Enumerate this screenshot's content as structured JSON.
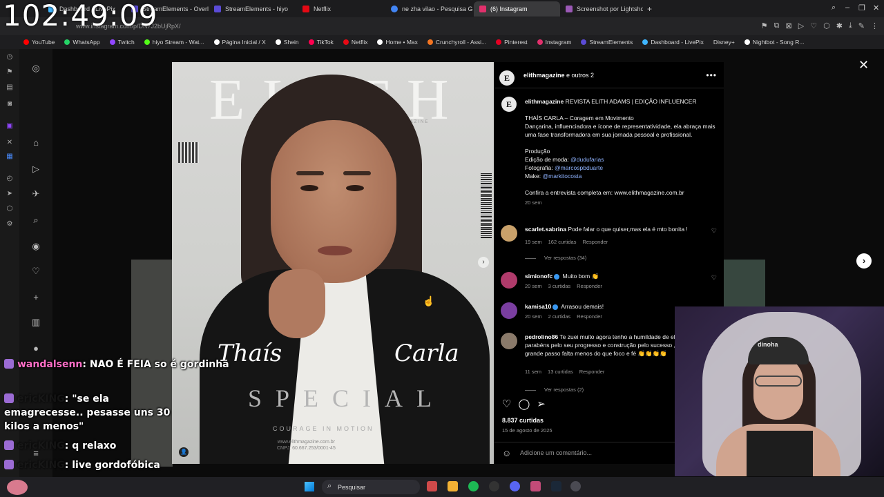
{
  "clock": "102:49:09",
  "browser": {
    "tabs": [
      {
        "label": "Dashboard - LivePix",
        "color": "#3fb5ff"
      },
      {
        "label": "StreamElements - Overlay",
        "color": "#5b4bd6"
      },
      {
        "label": "StreamElements - hiyo",
        "color": "#5b4bd6"
      },
      {
        "label": "Netflix",
        "color": "#e50914"
      },
      {
        "label": "ne zha vilao - Pesquisa G",
        "color": "#4285f4"
      },
      {
        "label": "(6) Instagram",
        "color": "#e1306c"
      },
      {
        "label": "Screenshot por Lightshot",
        "color": "#9b59b6"
      }
    ],
    "new_tab": "+",
    "url": "www.instagram.com/p/DN7J2bUjRpX/"
  },
  "bookmarks": [
    {
      "label": "YouTube",
      "color": "#ff0000"
    },
    {
      "label": "WhatsApp",
      "color": "#25d366"
    },
    {
      "label": "Twitch",
      "color": "#9146ff"
    },
    {
      "label": "hiyo Stream - Wat...",
      "color": "#53fc18"
    },
    {
      "label": "Página Inicial / X",
      "color": "#ffffff"
    },
    {
      "label": "Shein",
      "color": "#ffffff"
    },
    {
      "label": "TikTok",
      "color": "#ff0050"
    },
    {
      "label": "Netflix",
      "color": "#e50914"
    },
    {
      "label": "Home • Max",
      "color": "#ffffff"
    },
    {
      "label": "Crunchyroll - Assi...",
      "color": "#f47521"
    },
    {
      "label": "Pinterest",
      "color": "#e60023"
    },
    {
      "label": "Instagram",
      "color": "#e1306c"
    },
    {
      "label": "StreamElements",
      "color": "#5b4bd6"
    },
    {
      "label": "Dashboard - LivePix",
      "color": "#3fb5ff"
    },
    {
      "label": "Disney+",
      "color": "#113ccf"
    },
    {
      "label": "Nightbot - Song R...",
      "color": "#ffffff"
    }
  ],
  "cover": {
    "brand": "ELITH",
    "subtitle": "ADAMS MAGAZINE",
    "first_name": "Thaís",
    "last_name": "Carla",
    "special": "SPECIAL",
    "tagline": "COURAGE IN MOTION",
    "site": "www.elithmagazine.com.br",
    "cnpj": "CNPJ: 60.667.253/0001-45"
  },
  "post": {
    "header_user": "elithmagazine",
    "header_rest": " e outros 2",
    "caption_user": "elithmagazine",
    "caption_title": " REVISTA ELITH ADAMS | EDIÇÃO INFLUENCER",
    "caption_line1": "THAÍS CARLA – Coragem em Movimento",
    "caption_line2": "Dançarina, influenciadora e ícone de representatividade, ela abraça mais uma fase transformadora em sua jornada pessoal e profissional.",
    "producao": "Produção",
    "moda_label": "Edição de moda: ",
    "moda_mention": "@dudufarias",
    "foto_label": "Fotografia: ",
    "foto_mention": "@marcospbduarte",
    "make_label": "Make: ",
    "make_mention": "@markitocosta",
    "confira": "Confira a entrevista completa em: www.elithmagazine.com.br",
    "caption_time": "20 sem",
    "likes": "8.837 curtidas",
    "date": "15 de agosto de 2025",
    "add_comment_placeholder": "Adicione um comentário..."
  },
  "comments": [
    {
      "user": "scarlet.sabrina",
      "text": " Pode falar o que quiser,mas ela é mto bonita !",
      "time": "19 sem",
      "likes": "162 curtidas",
      "reply": "Responder",
      "replies": "Ver respostas (34)",
      "color": "#c9a16a"
    },
    {
      "user": "simionofc",
      "text": " Muito bom 👏",
      "time": "20 sem",
      "likes": "3 curtidas",
      "reply": "Responder",
      "replies": "",
      "color": "#b03b6b"
    },
    {
      "user": "kamisa10",
      "text": " Arrasou demais!",
      "time": "20 sem",
      "likes": "2 curtidas",
      "reply": "Responder",
      "replies": "",
      "color": "#7a3ea0"
    },
    {
      "user": "pedrolino86",
      "text": " Te zuei muito agora tenho a humildade de elogiar, parabéns pelo seu progresso e construção pelo sucesso , já deu um grande passo falta menos do que foco e fé 👏👏👏👏",
      "time": "11 sem",
      "likes": "13 curtidas",
      "reply": "Responder",
      "replies": "Ver respostas (2)",
      "color": "#8a7a6a"
    }
  ],
  "chat": [
    {
      "user": "wandalsenn",
      "text": ": NAO É FEIA so é gordinha"
    },
    {
      "user": "ericKING",
      "text": ": \"se ela emagrecesse.. pesasse uns 30 kilos a menos\""
    },
    {
      "user": "ericKING",
      "text": ": q relaxo"
    },
    {
      "user": "ericKING",
      "text": ": live gordofóbica"
    }
  ],
  "webcam": {
    "cap_text": "dinoha"
  },
  "taskbar": {
    "search_label": "Pesquisar"
  }
}
